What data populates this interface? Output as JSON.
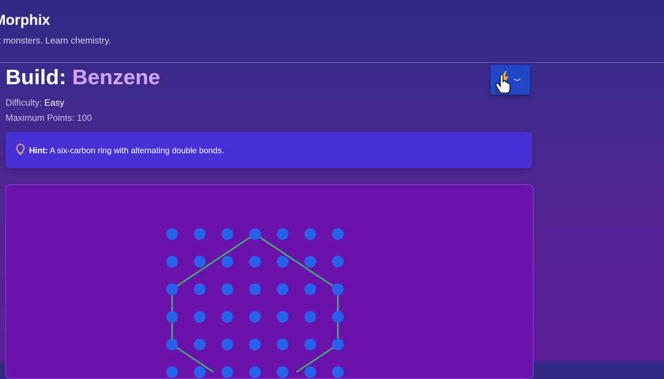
{
  "header": {
    "brand": "oMorphix",
    "tagline": "art monsters. Learn chemistry."
  },
  "challenge": {
    "title_prefix": "Build:",
    "molecule": "Benzene",
    "difficulty_label": "Difficulty:",
    "difficulty_value": "Easy",
    "points_label": "Maximum Points:",
    "points_value": "100"
  },
  "hint": {
    "label": "Hint:",
    "text": "A six-carbon ring with alternating double bonds."
  },
  "powerup": {
    "icon": "lightning-bolt-icon",
    "menu_icon": "chevron-down-icon"
  },
  "colors": {
    "grid_node": "#2563eb",
    "bond": "#3cb371",
    "hint_bg": "#4630d6",
    "board_bg": "#6c12ac",
    "accent": "#d4a7ff",
    "bolt": "#f2a93b"
  }
}
